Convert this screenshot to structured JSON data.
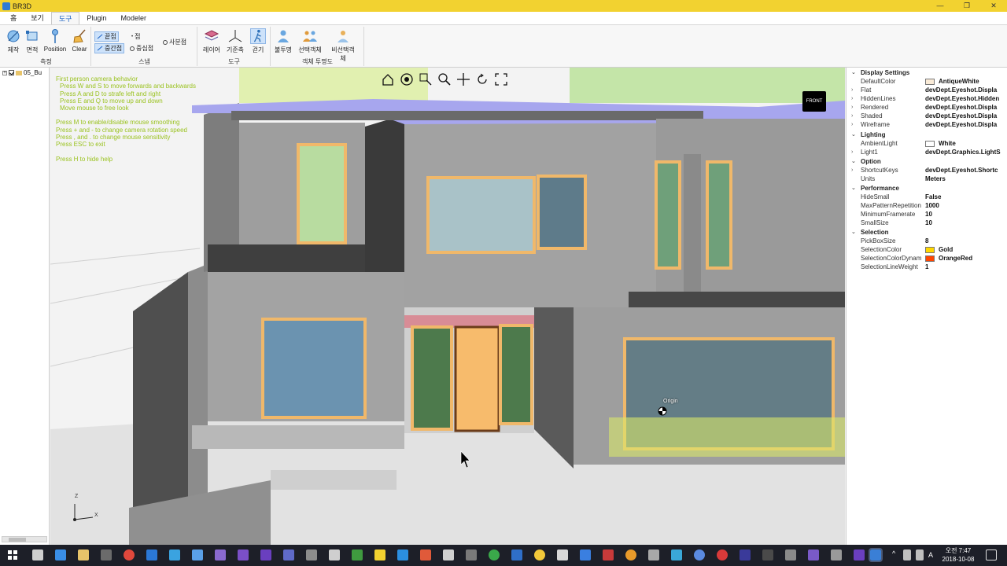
{
  "window": {
    "title": "BR3D",
    "controls": [
      "—",
      "❐",
      "✕"
    ]
  },
  "menu": {
    "tabs": [
      "홈",
      "보기",
      "도구",
      "Plugin",
      "Modeler"
    ],
    "active": "도구"
  },
  "ribbon": {
    "groups": [
      {
        "title": "측정",
        "buttons": [
          "제작",
          "면적",
          "Position",
          "Clear"
        ]
      },
      {
        "title": "스냅",
        "items": [
          "끝점",
          "점",
          "사분점",
          "중간점",
          "중심점"
        ]
      },
      {
        "title": "도구",
        "buttons": [
          "레이어",
          "기준축",
          "걷기"
        ]
      },
      {
        "title": "객체 투명도",
        "buttons": [
          "불투명",
          "선택객체",
          "비선택객체"
        ]
      }
    ]
  },
  "tree": {
    "item_label": "05_Bu"
  },
  "viewport": {
    "help_lines": [
      "First person camera behavior",
      "Press W and S to move forwards and backwards",
      "Press A and D to strafe left and right",
      "Press E and Q to move up and down",
      "Move mouse to free look",
      "",
      "Press M to enable/disable mouse smoothing",
      "Press + and - to change camera rotation speed",
      "Press , and . to change mouse sensitivity",
      "Press ESC to exit",
      "",
      "Press H to hide help"
    ],
    "viewcube_label": "FRONT",
    "origin_label": "Origin",
    "axis_z": "Z",
    "axis_x": "X"
  },
  "properties": {
    "categories": [
      {
        "name": "Display Settings",
        "rows": [
          {
            "name": "DefaultColor",
            "value": "AntiqueWhite",
            "swatch": "#faebd7"
          },
          {
            "name": "Flat",
            "value": "devDept.Eyeshot.Displa",
            "expandable": true
          },
          {
            "name": "HiddenLines",
            "value": "devDept.Eyeshot.Hidden",
            "expandable": true
          },
          {
            "name": "Rendered",
            "value": "devDept.Eyeshot.Displa",
            "expandable": true
          },
          {
            "name": "Shaded",
            "value": "devDept.Eyeshot.Displa",
            "expandable": true
          },
          {
            "name": "Wireframe",
            "value": "devDept.Eyeshot.Displa",
            "expandable": true
          }
        ]
      },
      {
        "name": "Lighting",
        "rows": [
          {
            "name": "AmbientLight",
            "value": "White",
            "swatch": "#ffffff"
          },
          {
            "name": "Light1",
            "value": "devDept.Graphics.LightS",
            "expandable": true
          }
        ]
      },
      {
        "name": "Option",
        "rows": [
          {
            "name": "ShortcutKeys",
            "value": "devDept.Eyeshot.Shortc",
            "expandable": true
          },
          {
            "name": "Units",
            "value": "Meters"
          }
        ]
      },
      {
        "name": "Performance",
        "rows": [
          {
            "name": "HideSmall",
            "value": "False"
          },
          {
            "name": "MaxPatternRepetition",
            "value": "1000"
          },
          {
            "name": "MinimumFramerate",
            "value": "10"
          },
          {
            "name": "SmallSize",
            "value": "10"
          }
        ]
      },
      {
        "name": "Selection",
        "rows": [
          {
            "name": "PickBoxSize",
            "value": "8"
          },
          {
            "name": "SelectionColor",
            "value": "Gold",
            "swatch": "#ffd700"
          },
          {
            "name": "SelectionColorDynam",
            "value": "OrangeRed",
            "swatch": "#ff4500"
          },
          {
            "name": "SelectionLineWeight",
            "value": "1"
          }
        ]
      }
    ]
  },
  "taskbar": {
    "time": "오전 7:47",
    "date": "2018-10-08",
    "ime": "A"
  }
}
